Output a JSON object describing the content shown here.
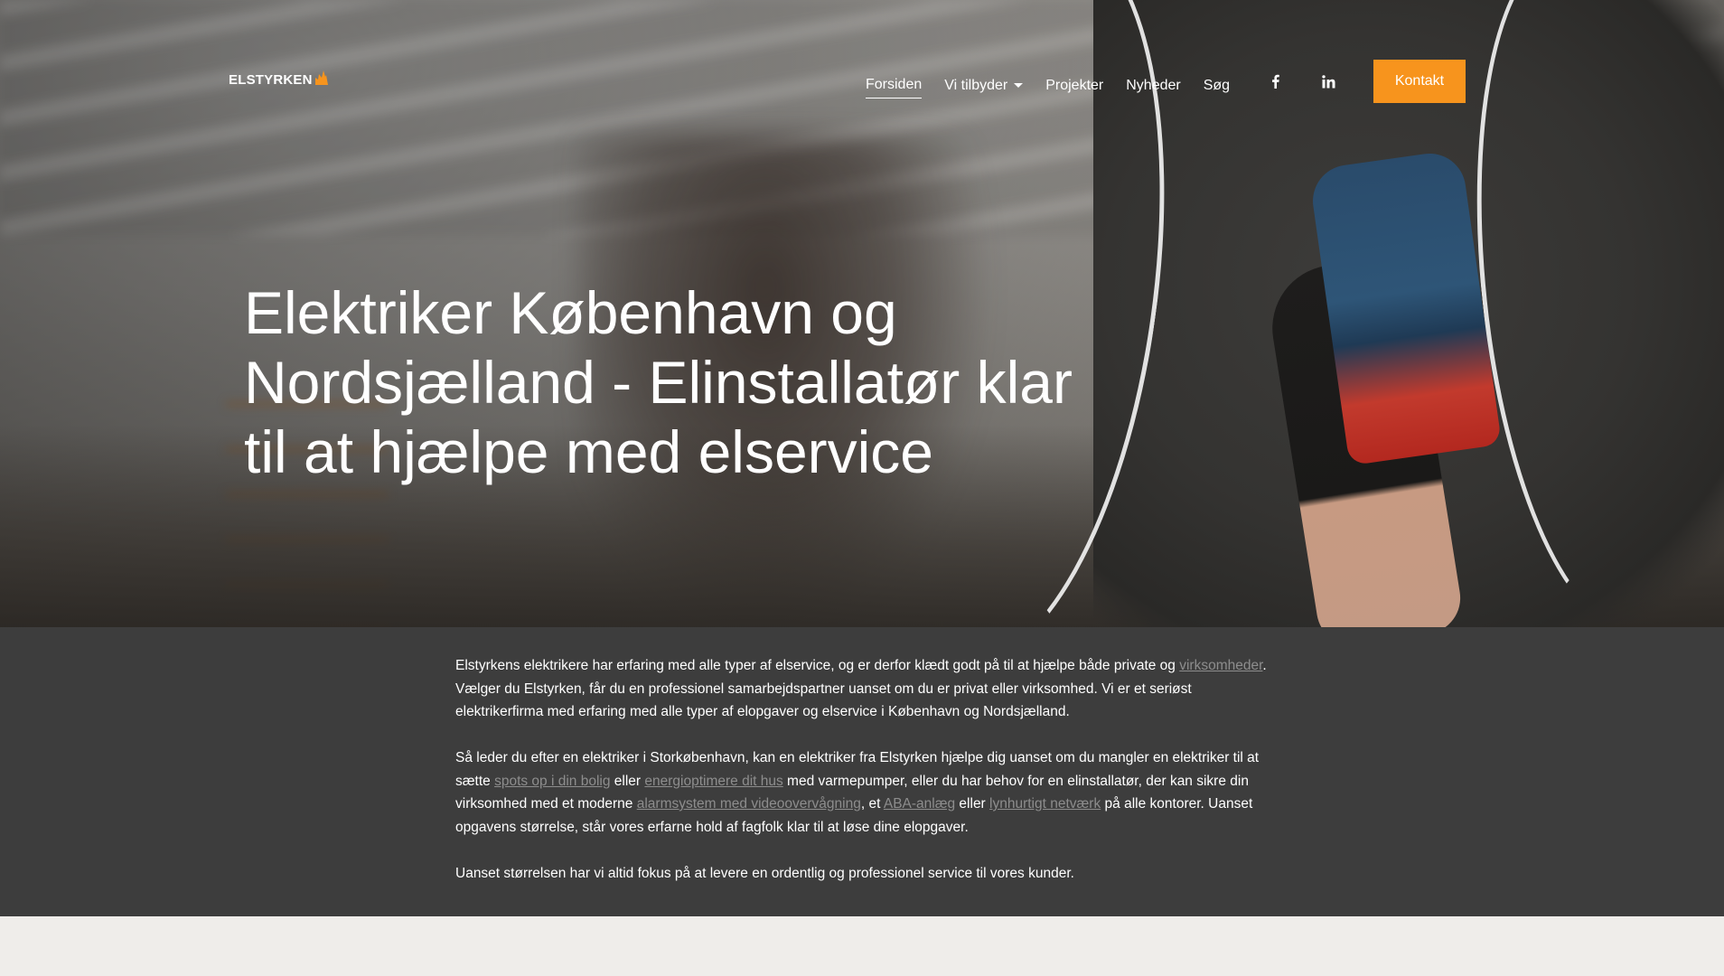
{
  "brand": {
    "logo_text": "ELSTYRKEN",
    "accent_color": "#f7941d"
  },
  "nav": {
    "items": [
      {
        "label": "Forsiden",
        "active": true
      },
      {
        "label": "Vi tilbyder",
        "has_dropdown": true
      },
      {
        "label": "Projekter"
      },
      {
        "label": "Nyheder"
      },
      {
        "label": "Søg"
      }
    ],
    "social": [
      "facebook-icon",
      "linkedin-icon"
    ],
    "contact_button": "Kontakt"
  },
  "hero": {
    "title": "Elektriker København og Nordsjælland - Elinstallatør klar til at hjælpe med elservice"
  },
  "content": {
    "p1": {
      "a": "Elstyrkens elektrikere har erfaring med alle typer af elservice, og er derfor klædt godt på til at hjælpe både private og ",
      "link1": "virksomheder",
      "b": ". Vælger du Elstyrken, får du en professionel samarbejdspartner uanset om du er privat eller virksomhed. Vi er et seriøst elektrikerfirma med erfaring med alle typer af elopgaver og elservice i København og Nordsjælland."
    },
    "p2": {
      "a": "Så leder du efter en elektriker i Storkøbenhavn, kan en elektriker fra Elstyrken hjælpe dig uanset om du mangler en elektriker til at sætte ",
      "link1": "spots op i din bolig",
      "b": " eller ",
      "link2": "energioptimere dit hus",
      "c": " med varmepumper, eller du har behov for en elinstallatør, der kan sikre din virksomhed med et moderne ",
      "link3": "alarmsystem med videoovervågning",
      "d": ", et ",
      "link4": "ABA-anlæg",
      "e": " eller ",
      "link5": "lynhurtigt netværk",
      "f": " på alle kontorer. Uanset opgavens størrelse, står vores erfarne hold af fagfolk klar til at løse dine elopgaver."
    },
    "p3": "Uanset størrelsen har vi altid fokus på at levere en ordentlig og professionel service til vores kunder."
  }
}
